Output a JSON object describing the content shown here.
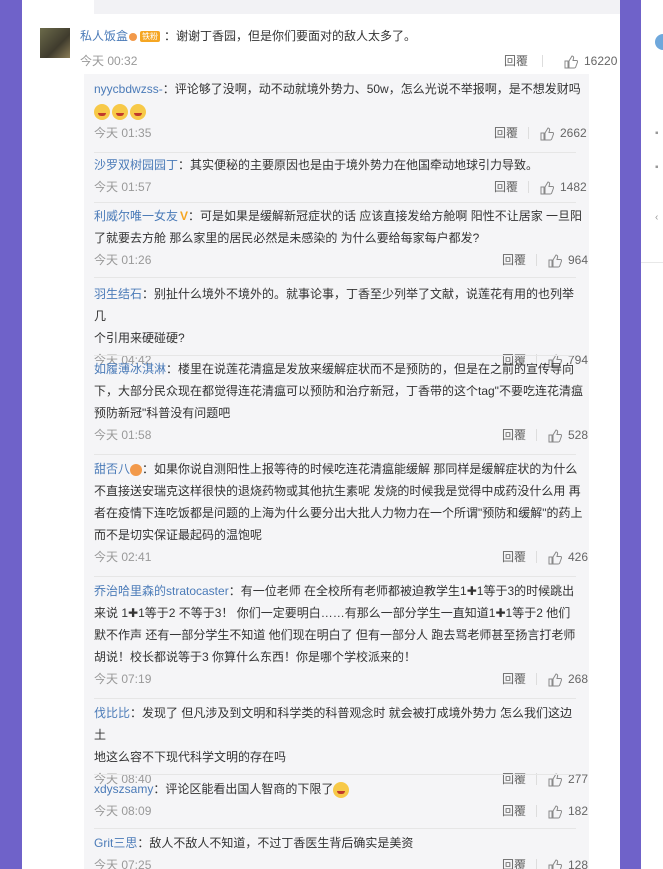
{
  "top_comment": {
    "user": "私人饭盒",
    "badge": "铁粉",
    "text": "：谢谢丁香园，但是你们要面对的敌人太多了。",
    "time": "今天 00:32",
    "reply_label": "回覆",
    "likes": "16220"
  },
  "replies": [
    {
      "user": "nyycbdwzss-",
      "text": "：评论够了没啊，动不动就境外势力、50w，怎么光说不举报啊，是不想发财吗",
      "emoji_count": 3,
      "time": "今天 01:35",
      "reply_label": "回覆",
      "likes": "2662"
    },
    {
      "user": "沙罗双树园园丁",
      "text": "：其实便秘的主要原因也是由于境外势力在他国牵动地球引力导致。",
      "time": "今天 01:57",
      "reply_label": "回覆",
      "likes": "1482"
    },
    {
      "user": "利威尔唯一女友",
      "vip": "V",
      "text_lines": [
        "：可是如果是缓解新冠症状的话 应该直接发给方舱啊 阳性不让居家 一旦阳",
        "了就要去方舱 那么家里的居民必然是未感染的 为什么要给每家每户都发?"
      ],
      "time": "今天 01:26",
      "reply_label": "回覆",
      "likes": "964"
    },
    {
      "user": "羽生结石",
      "text_lines": [
        "：别扯什么境外不境外的。就事论事，丁香至少列举了文献，说莲花有用的也列举几",
        "个引用来硬碰硬?"
      ],
      "time": "今天 04:42",
      "reply_label": "回覆",
      "likes": "794"
    },
    {
      "user": "如履薄冰淇淋",
      "text_lines": [
        "：楼里在说莲花清瘟是发放来缓解症状而不是预防的，但是在之前的宣传导向",
        "下，大部分民众现在都觉得连花清瘟可以预防和治疗新冠，丁香带的这个tag\"不要吃连花清瘟",
        "预防新冠\"科普没有问题吧"
      ],
      "time": "今天 01:58",
      "reply_label": "回覆",
      "likes": "528"
    },
    {
      "user": "甜否八",
      "text_lines": [
        "：如果你说自测阳性上报等待的时候吃连花清瘟能缓解 那同样是缓解症状的为什么",
        "不直接送安瑞克这样很快的退烧药物或其他抗生素呢 发烧的时候我是觉得中成药没什么用 再",
        "者在疫情下连吃饭都是问题的上海为什么要分出大批人力物力在一个所谓\"预防和缓解\"的药上",
        "而不是切实保证最起码的温饱呢"
      ],
      "time": "今天 02:41",
      "reply_label": "回覆",
      "likes": "426"
    },
    {
      "user": "乔治哈里森的stratocaster",
      "text_lines": [
        "：有一位老师 在全校所有老师都被迫教学生1",
        "1等于3的时候跳出",
        "来说 1",
        "1等于2 不等于3！ 你们一定要明白……有那么一部分学生一直知道1",
        "1等于2 他们",
        "默不作声 还有一部分学生不知道 他们现在明白了 但有一部分人 跑去骂老师甚至扬言打老师",
        "胡说！校长都说等于3 你算什么东西！你是哪个学校派来的！"
      ],
      "time": "今天 07:19",
      "reply_label": "回覆",
      "likes": "268"
    },
    {
      "user": "伐比比",
      "text_lines": [
        "：发现了 但凡涉及到文明和科学类的科普观念时 就会被打成境外势力 怎么我们这边土",
        "地这么容不下现代科学文明的存在吗"
      ],
      "time": "今天 08:40",
      "reply_label": "回覆",
      "likes": "277"
    },
    {
      "user": "xdyszsamy",
      "text": "：评论区能看出国人智商的下限了",
      "time": "今天 08:09",
      "reply_label": "回覆",
      "likes": "182"
    },
    {
      "user": "Grit三思",
      "text": "：敌人不敌人不知道，不过丁香医生背后确实是美资",
      "time": "今天 07:25",
      "reply_label": "回覆",
      "likes": "128"
    }
  ],
  "colors": {
    "background": "#6f62c9",
    "username": "#4b7bb8",
    "username_top": "#eb7350",
    "meta": "#999999"
  },
  "icons": {
    "like": "thumbs-up-icon",
    "vip": "vip-v-icon",
    "badge": "fan-badge-icon"
  }
}
